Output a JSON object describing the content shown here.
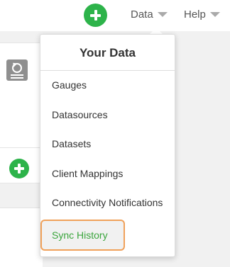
{
  "topbar": {
    "data_label": "Data",
    "help_label": "Help"
  },
  "dropdown": {
    "title": "Your Data",
    "items": [
      {
        "label": "Gauges"
      },
      {
        "label": "Datasources"
      },
      {
        "label": "Datasets"
      },
      {
        "label": "Client Mappings"
      },
      {
        "label": "Connectivity Notifications"
      },
      {
        "label": "Sync History",
        "active": true
      }
    ]
  },
  "colors": {
    "accent_green": "#2db34a",
    "active_text": "#3aa53c",
    "highlight_border": "#f0a15a"
  }
}
